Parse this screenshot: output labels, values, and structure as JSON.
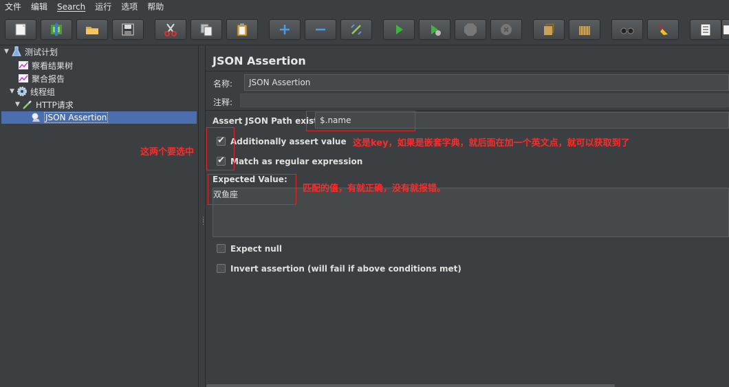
{
  "menu": {
    "file": "文件",
    "edit": "编辑",
    "search": "Search",
    "run": "运行",
    "options": "选项",
    "help": "帮助"
  },
  "toolbar": {
    "buttons": [
      "new-icon",
      "templates-icon",
      "open-icon",
      "save-icon",
      "cut-icon",
      "copy-icon",
      "paste-icon",
      "expand-icon",
      "collapse-icon",
      "toggle-icon",
      "start-icon",
      "start-no-pause-icon",
      "stop-icon",
      "shutdown-icon",
      "remote-clear-icon",
      "clear-all-icon",
      "search-icon",
      "reset-search-icon",
      "function-helper-icon",
      "help-icon"
    ]
  },
  "tree": {
    "items": [
      {
        "label": "测试计划",
        "icon": "flask-icon"
      },
      {
        "label": "察看结果树",
        "icon": "chart-icon"
      },
      {
        "label": "聚合报告",
        "icon": "chart-icon"
      },
      {
        "label": "线程组",
        "icon": "gear-icon"
      },
      {
        "label": "HTTP请求",
        "icon": "pipette-icon"
      },
      {
        "label": "JSON Assertion",
        "icon": "magnifier-icon"
      }
    ]
  },
  "panel": {
    "title": "JSON Assertion",
    "name_label": "名称:",
    "name_value": "JSON Assertion",
    "comment_label": "注释:",
    "comment_value": "",
    "json_path_label": "Assert JSON Path exists:",
    "json_path_value": "$.name",
    "additionally_assert_label": "Additionally assert value",
    "additionally_assert_checked": true,
    "regex_label": "Match as regular expression",
    "regex_checked": true,
    "expected_value_label": "Expected Value:",
    "expected_value": "双鱼座",
    "expect_null_label": "Expect null",
    "expect_null_checked": false,
    "invert_label": "Invert assertion (will fail if above conditions met)",
    "invert_checked": false
  },
  "annotations": {
    "key_note": "这是key，如果是嵌套字典，就后面在加一个英文点，就可以获取到了",
    "select_note": "这两个要选中",
    "value_note": "匹配的值，有就正确，没有就报错。"
  },
  "colors": {
    "background": "#3c3f41",
    "selection": "#4b6eaf",
    "annotation_red": "#ff2a2a"
  }
}
